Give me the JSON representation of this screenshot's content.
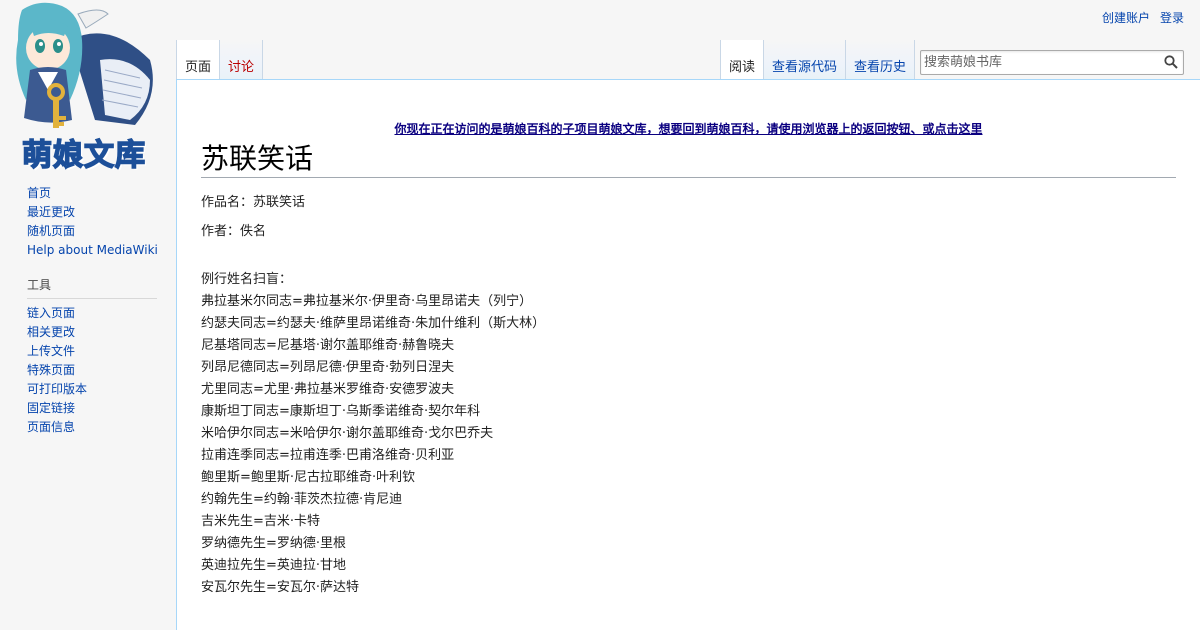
{
  "logo": {
    "text": "萌娘文库"
  },
  "personal_tools": {
    "create_account": "创建账户",
    "login": "登录"
  },
  "navigation": {
    "items": [
      "首页",
      "最近更改",
      "随机页面",
      "Help about MediaWiki"
    ]
  },
  "tools": {
    "heading": "工具",
    "items": [
      "链入页面",
      "相关更改",
      "上传文件",
      "特殊页面",
      "可打印版本",
      "固定链接",
      "页面信息"
    ]
  },
  "tabs": {
    "page": "页面",
    "talk": "讨论",
    "read": "阅读",
    "view_source": "查看源代码",
    "history": "查看历史"
  },
  "search": {
    "placeholder": "搜索萌娘书库"
  },
  "sitenotice": "你现在正在访问的是萌娘百科的子项目萌娘文库，想要回到萌娘百科，请使用浏览器上的返回按钮、或点击这里",
  "article": {
    "title": "苏联笑话",
    "work_name": "作品名：苏联笑话",
    "author": "作者：佚名",
    "names": [
      "例行姓名扫盲：",
      "弗拉基米尔同志=弗拉基米尔·伊里奇·乌里昂诺夫（列宁）",
      "约瑟夫同志=约瑟夫·维萨里昂诺维奇·朱加什维利（斯大林）",
      "尼基塔同志=尼基塔·谢尔盖耶维奇·赫鲁晓夫",
      "列昂尼德同志=列昂尼德·伊里奇·勃列日涅夫",
      "尤里同志=尤里·弗拉基米罗维奇·安德罗波夫",
      "康斯坦丁同志=康斯坦丁·乌斯季诺维奇·契尔年科",
      "米哈伊尔同志=米哈伊尔·谢尔盖耶维奇·戈尔巴乔夫",
      "拉甫连季同志=拉甫连季·巴甫洛维奇·贝利亚",
      "鲍里斯=鲍里斯·尼古拉耶维奇·叶利钦",
      "约翰先生=约翰·菲茨杰拉德·肯尼迪",
      "吉米先生=吉米·卡特",
      "罗纳德先生=罗纳德·里根",
      "英迪拉先生=英迪拉·甘地",
      "安瓦尔先生=安瓦尔·萨达特"
    ]
  }
}
